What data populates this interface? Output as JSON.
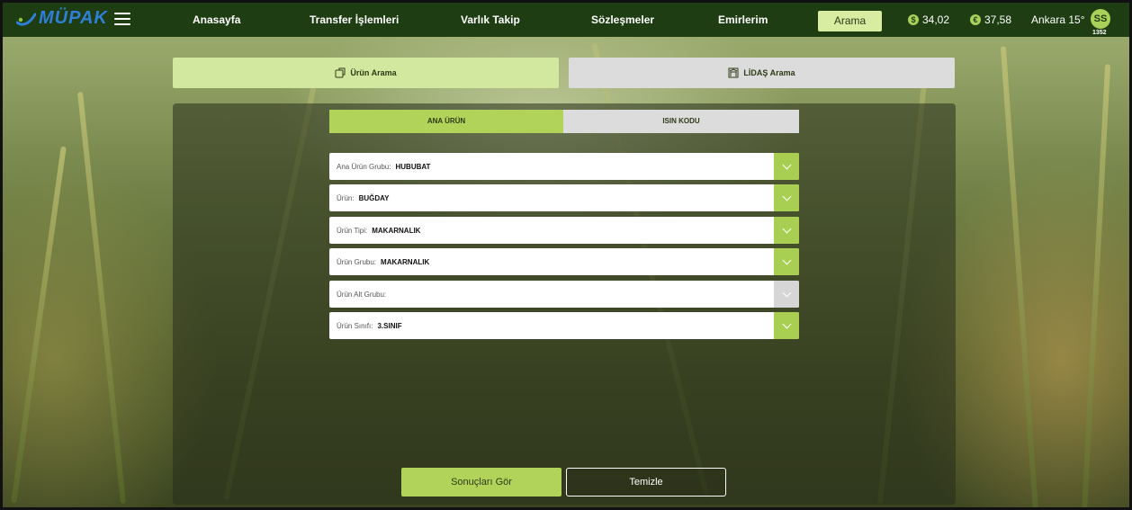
{
  "brand": {
    "logo_text": "MÜPAK"
  },
  "nav": {
    "items": [
      {
        "label": "Anasayfa"
      },
      {
        "label": "Transfer İşlemleri"
      },
      {
        "label": "Varlık Takip"
      },
      {
        "label": "Sözleşmeler"
      },
      {
        "label": "Emirlerim"
      }
    ],
    "active_label": "Arama"
  },
  "rates": {
    "usd": {
      "icon": "dollar-icon",
      "value": "34,02"
    },
    "eur": {
      "icon": "euro-icon",
      "value": "37,58"
    }
  },
  "weather": "Ankara 15°",
  "user": {
    "initials": "SS",
    "number": "1352"
  },
  "search_types": {
    "urun": {
      "label": "Ürün Arama",
      "icon": "product-icon"
    },
    "lidas": {
      "label": "LİDAŞ Arama",
      "icon": "building-icon"
    }
  },
  "subtabs": {
    "ana_urun": "ANA ÜRÜN",
    "isin_kodu": "ISIN KODU"
  },
  "fields": [
    {
      "label": "Ana Ürün Grubu:",
      "value": "HUBUBAT",
      "enabled": true
    },
    {
      "label": "Ürün:",
      "value": "BUĞDAY",
      "enabled": true
    },
    {
      "label": "Ürün Tipi:",
      "value": "MAKARNALIK",
      "enabled": true
    },
    {
      "label": "Ürün Grubu:",
      "value": "MAKARNALIK",
      "enabled": true
    },
    {
      "label": "Ürün Alt Grubu:",
      "value": "",
      "enabled": false
    },
    {
      "label": "Ürün Sınıfı:",
      "value": "3.SINIF",
      "enabled": true
    }
  ],
  "actions": {
    "show_results": "Sonuçları Gör",
    "clear": "Temizle"
  },
  "colors": {
    "topbar": "#1f3d12",
    "accent": "#a9cf52",
    "active_tab": "#d2e89e",
    "inactive_tab": "#dcdcdc"
  }
}
